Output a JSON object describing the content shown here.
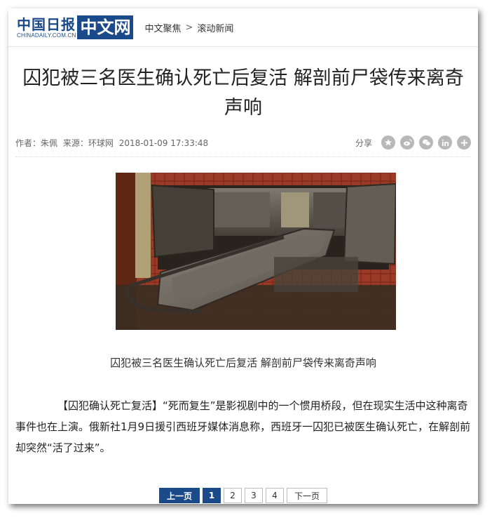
{
  "header": {
    "logo_cn": "中国日报",
    "logo_en": "CHINADAILY.COM.CN",
    "logo_box": "中文网",
    "breadcrumb": [
      "中文聚焦",
      "滚动新闻"
    ],
    "breadcrumb_sep": ">"
  },
  "article": {
    "title": "囚犯被三名医生确认死亡后复活 解剖前尸袋传来离奇声响",
    "author": "作者：朱佩",
    "source": "来源：环球网",
    "datetime": "2018-01-09 17:33:48",
    "share_label": "分享",
    "share_icons": [
      "star-icon",
      "weibo-icon",
      "wechat-icon",
      "linkedin-icon",
      "plus-icon"
    ],
    "photo_alt": "morgue cold chamber drawer",
    "caption": "囚犯被三名医生确认死亡后复活 解剖前尸袋传来离奇声响",
    "body": "【囚犯确认死亡复活】“死而复生”是影视剧中的一个惯用桥段，但在现实生活中这种离奇事件也在上演。俄新社1月9日援引西班牙媒体消息称，西班牙一囚犯已被医生确认死亡，在解剖前却突然“活了过来”。"
  },
  "pager": {
    "prev": "上一页",
    "pages": [
      "1",
      "2",
      "3",
      "4"
    ],
    "current": "1",
    "next": "下一页"
  },
  "colors": {
    "brand": "#1b4a8a",
    "icon_gray": "#b8b8b8"
  }
}
